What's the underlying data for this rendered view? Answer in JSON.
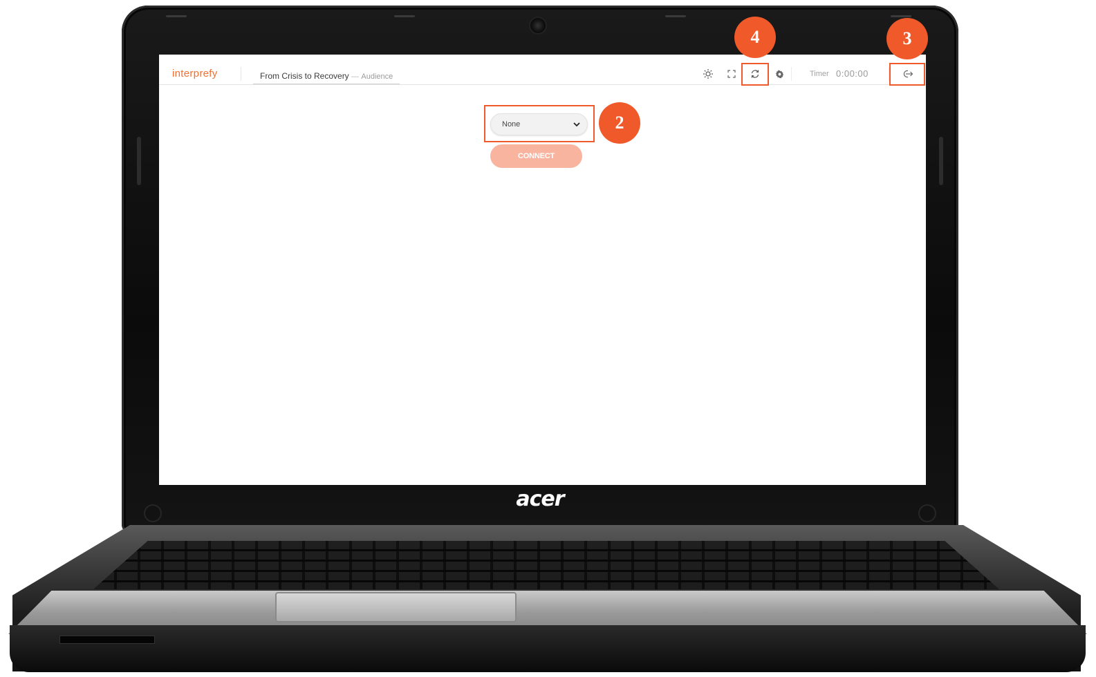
{
  "app": {
    "logo": "interprefy",
    "event_title": "From Crisis to Recovery",
    "event_separator": "—",
    "event_role": "Audience"
  },
  "toolbar": {
    "icons": [
      "brightness-icon",
      "fullscreen-icon",
      "refresh-icon",
      "gear-icon",
      "logout-icon"
    ],
    "timer_label": "Timer",
    "timer_value": "0:00:00"
  },
  "main": {
    "language_select": {
      "selected": "None"
    },
    "connect_label": "CONNECT"
  },
  "annotations": {
    "badges": [
      "2",
      "3",
      "4"
    ],
    "color": "#f0592a"
  },
  "device": {
    "brand": "acer"
  },
  "colors": {
    "brand_orange": "#f26f32",
    "connect_disabled": "#f8b49e"
  }
}
